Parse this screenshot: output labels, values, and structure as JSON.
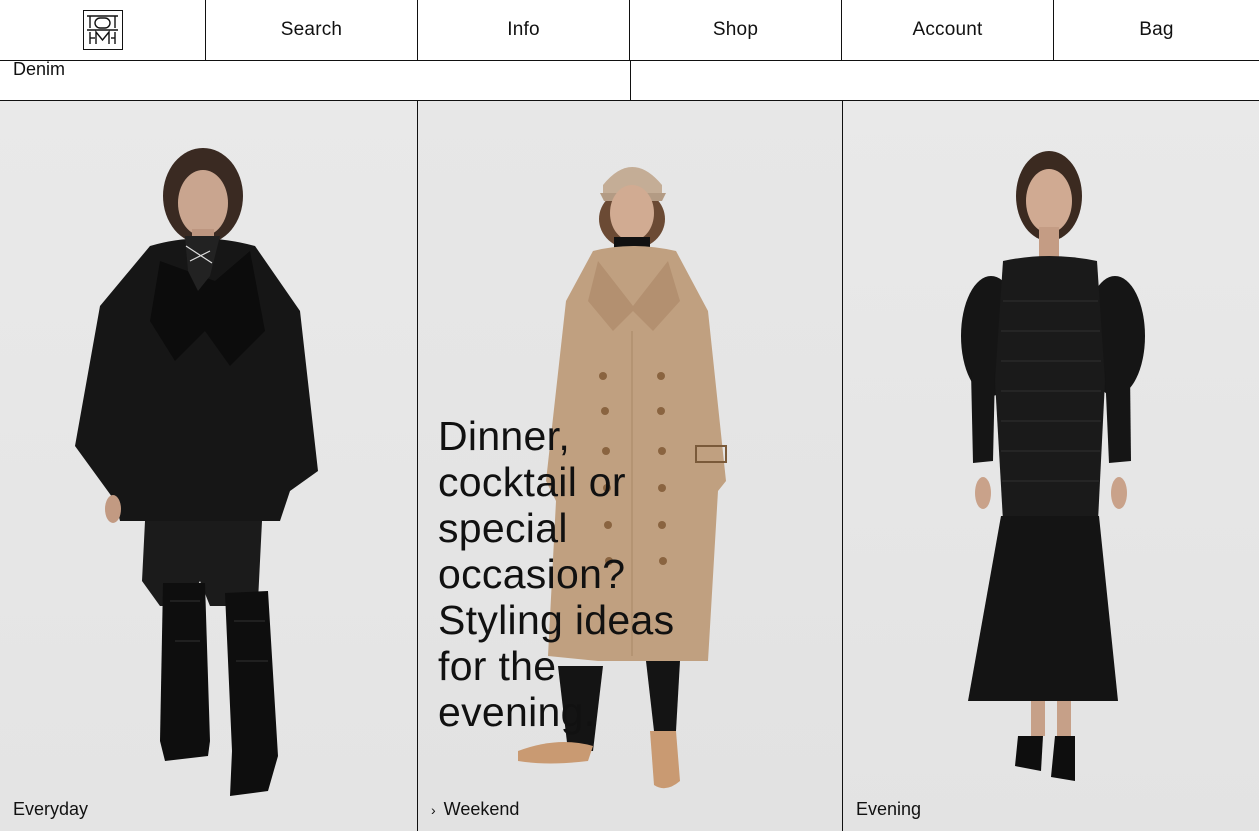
{
  "nav": {
    "logo_icon": "monogram-logo-icon",
    "items": [
      "Search",
      "Info",
      "Shop",
      "Account",
      "Bag"
    ]
  },
  "filter": {
    "active_category": "Denim"
  },
  "cards": [
    {
      "label": "Everyday",
      "outfit": "black wrap coat, black trousers, black croc boots"
    },
    {
      "label": "Weekend",
      "headline": "Dinner, cocktail or special occasion? Styling ideas for the evening.",
      "chevron_icon": "chevron-right-icon"
    },
    {
      "label": "Evening"
    }
  ],
  "colors": {
    "border": "#111111",
    "background": "#ffffff",
    "photo_bg": "#e6e6e6",
    "text": "#111111"
  }
}
